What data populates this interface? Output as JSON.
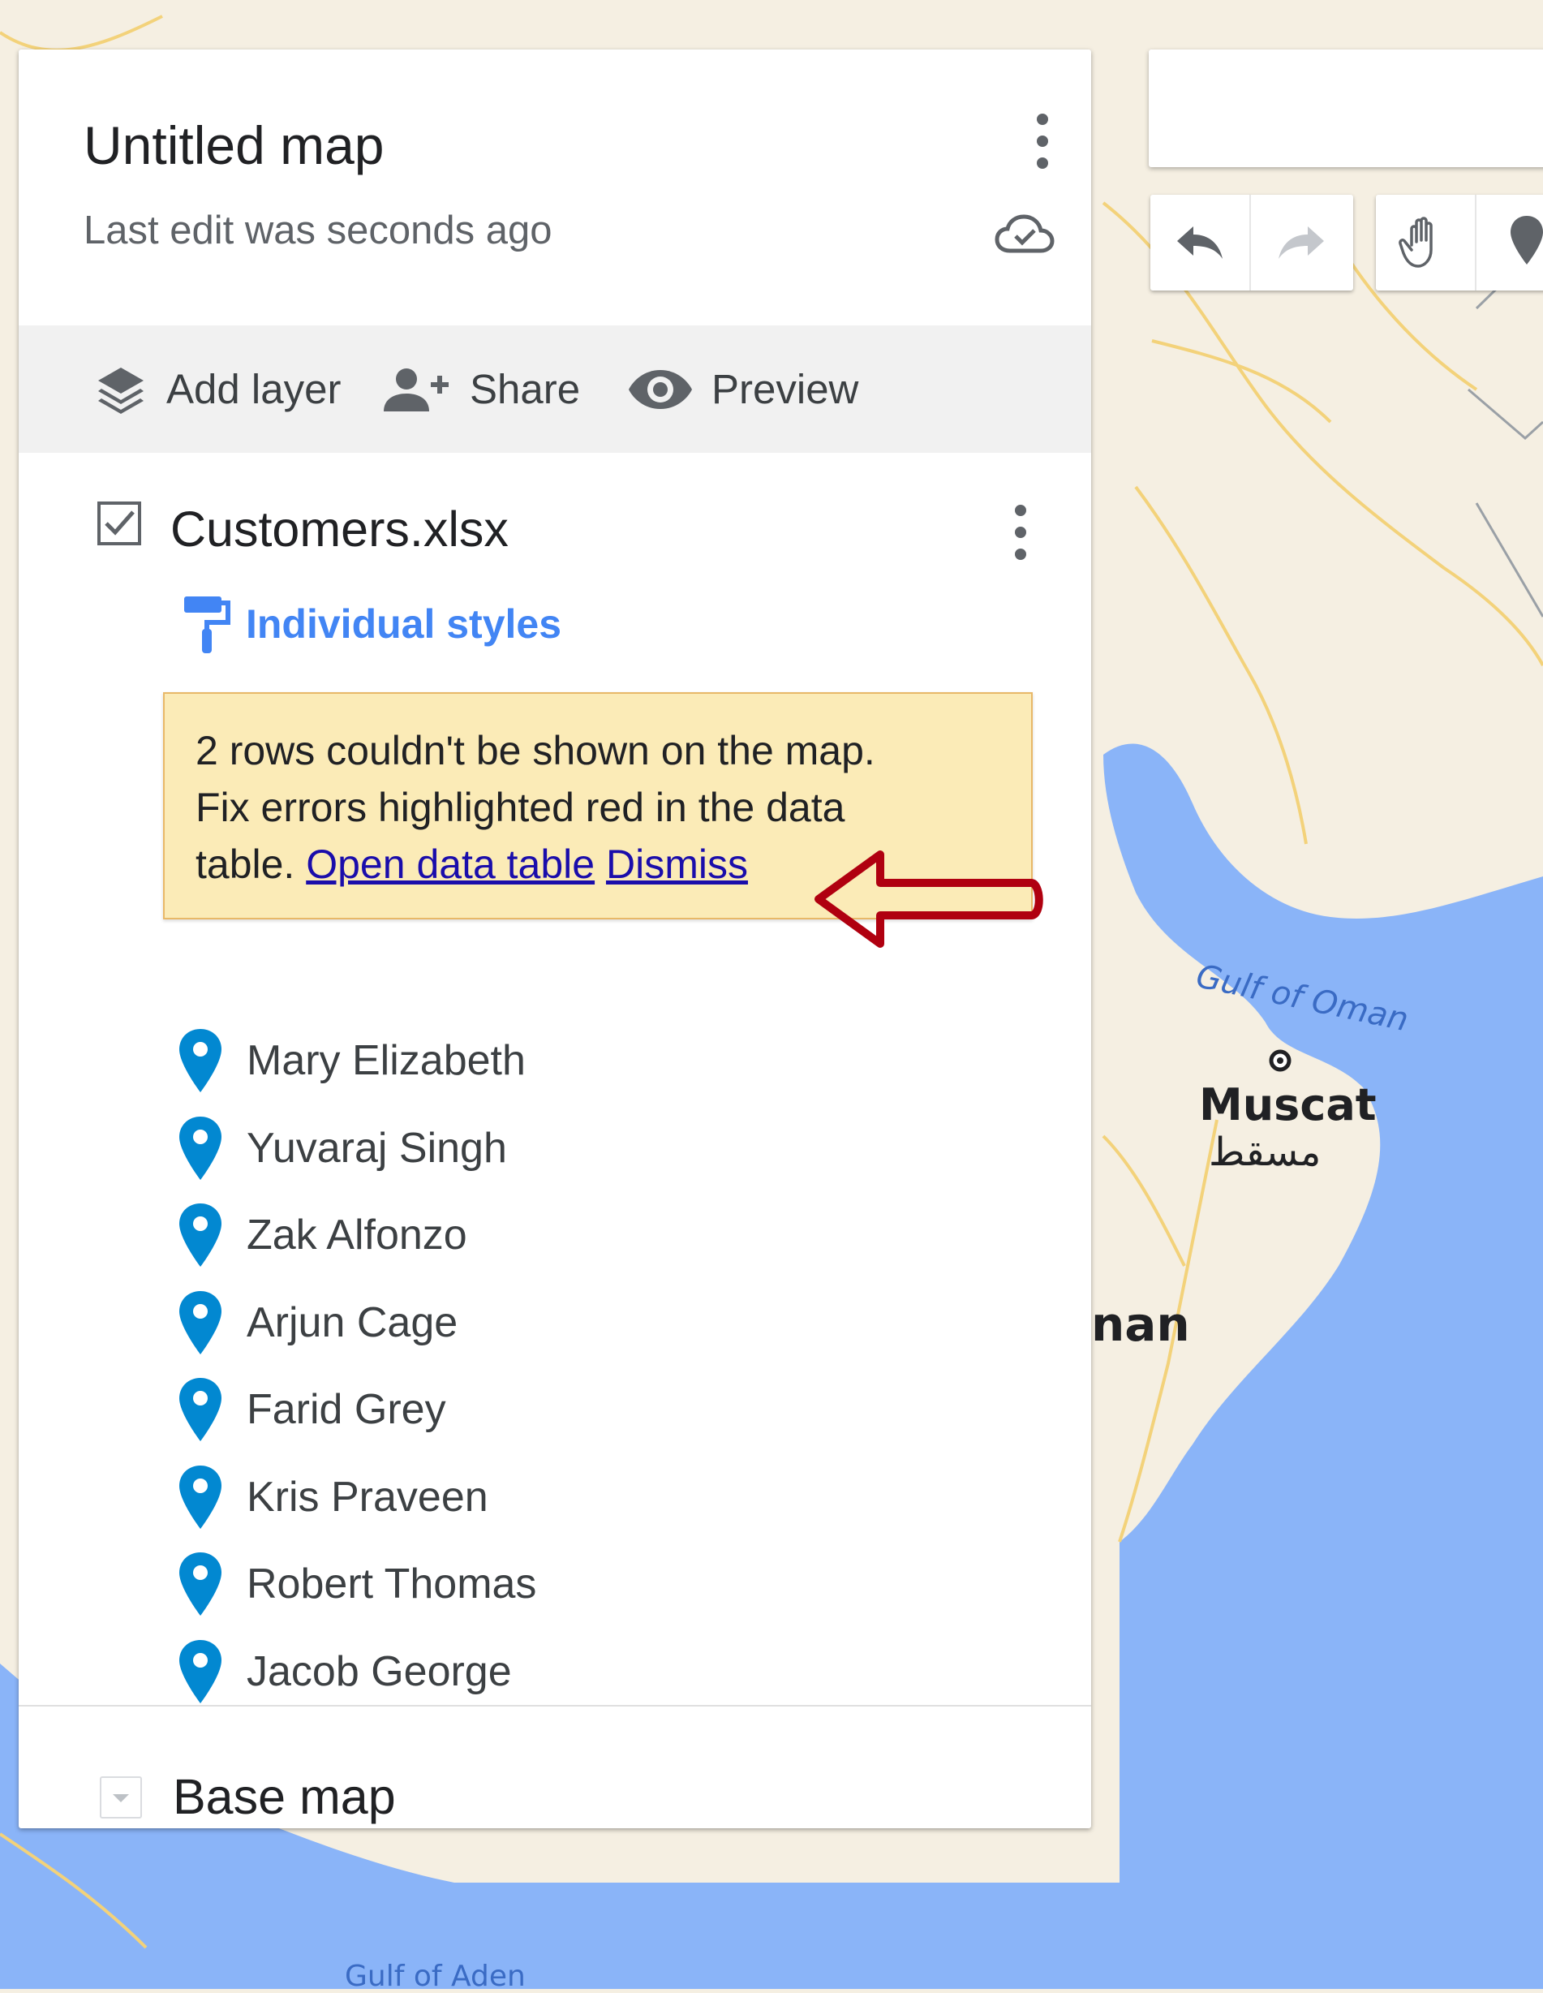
{
  "map": {
    "labels": {
      "gulf_of_oman": "Gulf of Oman",
      "muscat": "Muscat",
      "muscat_arabic": "مسقط",
      "oman_partial": "nan",
      "gulf_of_aden": "Gulf of Aden"
    }
  },
  "panel": {
    "title": "Untitled map",
    "subtitle": "Last edit was seconds ago",
    "toolbar": {
      "add_layer": "Add layer",
      "share": "Share",
      "preview": "Preview"
    },
    "layer": {
      "name": "Customers.xlsx",
      "checked": true,
      "style_label": "Individual styles",
      "notice": {
        "line1": "2 rows couldn't be shown on the map.",
        "line2": "Fix errors highlighted red in the data",
        "line3": "table.",
        "open_link": "Open data table",
        "dismiss_link": "Dismiss"
      },
      "features": [
        "Mary Elizabeth",
        "Yuvaraj Singh",
        "Zak Alfonzo",
        "Arjun Cage",
        "Farid Grey",
        "Kris Praveen",
        "Robert Thomas",
        "Jacob George"
      ]
    },
    "base_map": {
      "label": "Base map"
    }
  },
  "colors": {
    "link": "#1a0dab",
    "style_link": "#4285f4",
    "marker": "#0288d1",
    "notice_bg": "#fbebb7",
    "annotation_arrow": "#b00010",
    "water": "#8ab4f8",
    "land": "#f5efe2"
  },
  "icons": [
    "kebab-menu-icon",
    "cloud-sync-icon",
    "layers-icon",
    "person-add-icon",
    "eye-icon",
    "checkbox-checked-icon",
    "paint-roller-icon",
    "map-marker-icon",
    "undo-icon",
    "redo-icon",
    "hand-pan-icon",
    "add-marker-icon",
    "dropdown-arrow-icon"
  ]
}
